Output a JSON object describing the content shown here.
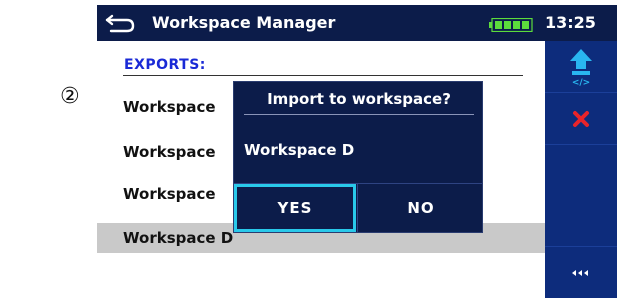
{
  "annotation": {
    "marker": "②"
  },
  "titlebar": {
    "back_icon": "return-arrow-icon",
    "title": "Workspace Manager",
    "battery_icon": "battery-full-icon",
    "time": "13:25"
  },
  "exports": {
    "header": "EXPORTS:",
    "items": [
      {
        "label": "Workspace"
      },
      {
        "label": "Workspace"
      },
      {
        "label": "Workspace"
      },
      {
        "label": "Workspace D",
        "selected": true
      }
    ]
  },
  "sidebar": {
    "buttons": [
      {
        "icon": "import-upload-icon"
      },
      {
        "icon": "delete-x-icon"
      },
      {
        "icon": "more-options-icon"
      }
    ]
  },
  "dialog": {
    "title": "Import to workspace?",
    "message": "Workspace D",
    "yes_label": "YES",
    "no_label": "NO"
  },
  "colors": {
    "titlebar": "#0c1c4a",
    "sidebar": "#0d2c7c",
    "header_text": "#1a2ad6",
    "selected_row": "#c9c9c9",
    "focus_border": "#29c9ea",
    "delete_red": "#e8242a",
    "import_arrow": "#29b6f0"
  }
}
